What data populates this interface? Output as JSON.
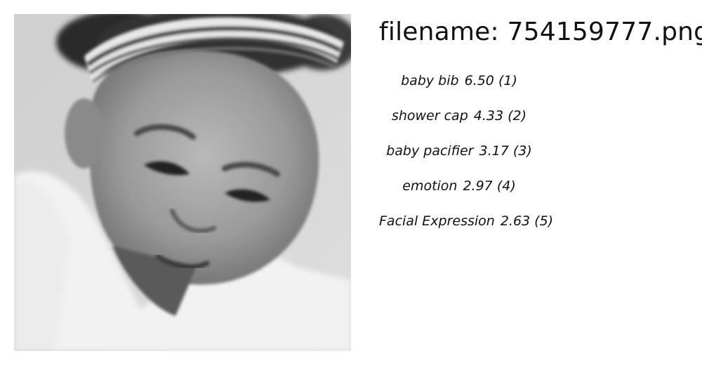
{
  "filename_prefix": "filename: ",
  "filename": "754159777.png",
  "photo": {
    "subject": "grayscale close-up of a child wearing a striped headband"
  },
  "labels": [
    {
      "name": "baby bib",
      "score": "6.50",
      "rank": "(1)"
    },
    {
      "name": "shower cap",
      "score": "4.33",
      "rank": "(2)"
    },
    {
      "name": "baby pacifier",
      "score": "3.17",
      "rank": "(3)"
    },
    {
      "name": "emotion",
      "score": "2.97",
      "rank": "(4)"
    },
    {
      "name": "Facial Expression",
      "score": "2.63",
      "rank": "(5)"
    }
  ]
}
